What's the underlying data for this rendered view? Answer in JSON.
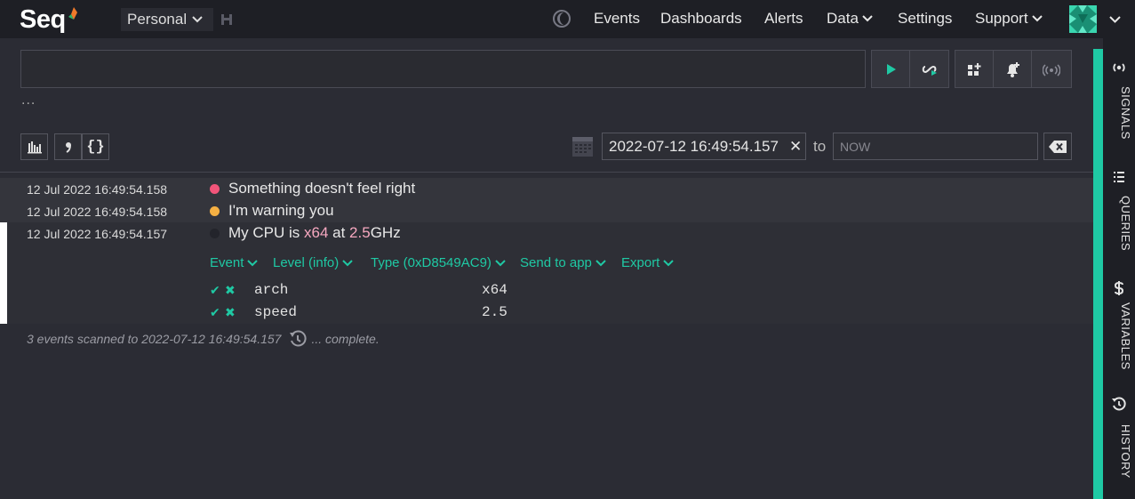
{
  "app": {
    "logo_text": "Seq",
    "workspace": "Personal"
  },
  "nav": {
    "items": [
      {
        "label": "Events"
      },
      {
        "label": "Dashboards"
      },
      {
        "label": "Alerts"
      },
      {
        "label": "Data"
      },
      {
        "label": "Settings"
      },
      {
        "label": "Support"
      }
    ]
  },
  "search": {
    "query_value": "",
    "ellipsis": "...",
    "range_from": "2022-07-12 16:49:54.157",
    "range_to_label": "to",
    "range_to_placeholder": "NOW"
  },
  "events": [
    {
      "timestamp": "12 Jul 2022  16:49:54.158",
      "level_color": "#f2557a",
      "message": "Something doesn't feel right"
    },
    {
      "timestamp": "12 Jul 2022  16:49:54.158",
      "level_color": "#f5b043",
      "message": "I'm warning you"
    },
    {
      "timestamp": "12 Jul 2022  16:49:54.157",
      "level_color": "#23242b",
      "message_parts": [
        "My CPU is ",
        "x64",
        " at ",
        "2.5",
        "GHz"
      ]
    }
  ],
  "event_actions": [
    {
      "label": "Event"
    },
    {
      "label": "Level (info)"
    },
    {
      "label": "Type (0xD8549AC9)"
    },
    {
      "label": "Send to app"
    },
    {
      "label": "Export"
    }
  ],
  "properties": [
    {
      "name": "arch",
      "value": "x64"
    },
    {
      "name": "speed",
      "value": "2.5"
    }
  ],
  "status": {
    "text": "3 events scanned to 2022-07-12 16:49:54.157",
    "suffix": "... complete."
  },
  "sidebar": {
    "tabs": [
      {
        "label": "SIGNALS",
        "icon": "signals-icon"
      },
      {
        "label": "QUERIES",
        "icon": "queries-icon"
      },
      {
        "label": "VARIABLES",
        "icon": "dollar-icon"
      },
      {
        "label": "HISTORY",
        "icon": "history-icon"
      }
    ]
  },
  "colors": {
    "accent": "#1fc9a4",
    "background": "#2b2c34",
    "nav_background": "#1e1f25",
    "error": "#f2557a",
    "warning": "#f5b043",
    "token_highlight": "#f6a8c0"
  }
}
